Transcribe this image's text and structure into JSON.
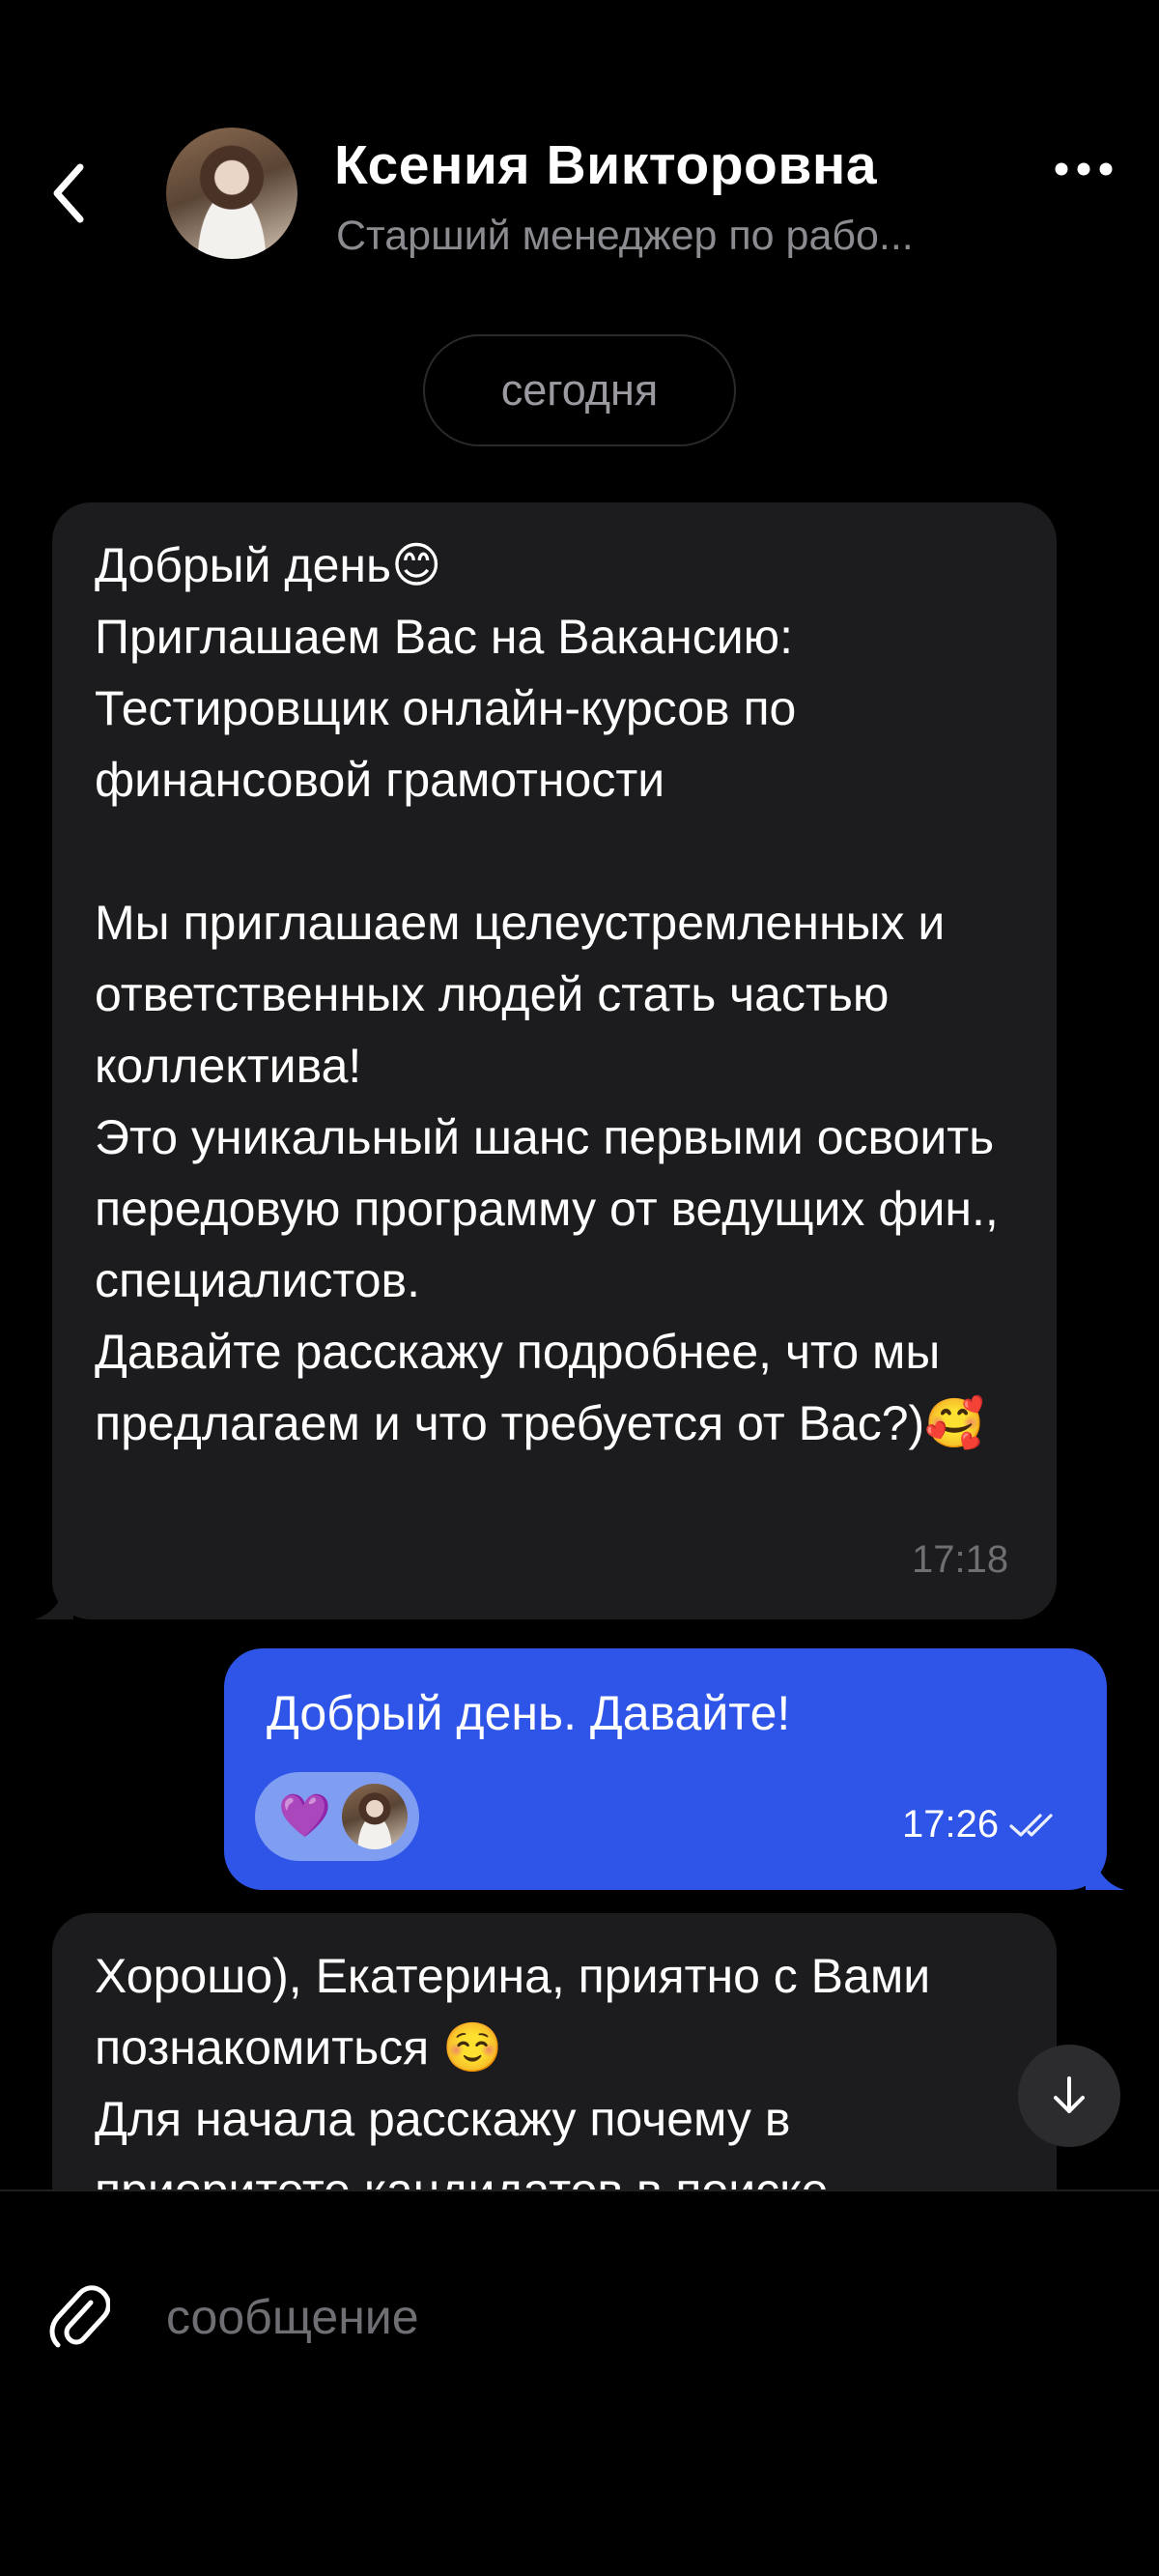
{
  "header": {
    "back_icon": "chevron-left-icon",
    "contact_name": "Ксения Викторовна",
    "contact_subtitle": "Старший менеджер по рабо...",
    "more_icon": "more-horizontal-icon"
  },
  "date_separator": "сегодня",
  "messages": [
    {
      "direction": "incoming",
      "text": "Добрый день😊\nПриглашаем Вас на Вакансию: \nТестировщик онлайн-курсов по финансовой грамотности\n\nМы приглашаем целеустремленных и ответственных людей стать частью коллектива!\nЭто уникальный шанс первыми освоить передовую программу от ведущих фин., специалистов.\nДавайте расскажу подробнее, что мы предлагаем и что требуется от Вас?)🥰",
      "time": "17:18"
    },
    {
      "direction": "outgoing",
      "text": "Добрый день. Давайте!",
      "time": "17:26",
      "status_icon": "double-check-icon",
      "reaction": "💜"
    },
    {
      "direction": "incoming",
      "text": "Хорошо), Екатерина, приятно с Вами познакомиться ☺️\nДля начала расскажу почему в\nприоритете кандидатов в поиске"
    }
  ],
  "composer": {
    "attach_icon": "paperclip-icon",
    "placeholder": "сообщение"
  },
  "scroll_down_icon": "arrow-down-icon",
  "colors": {
    "background": "#000000",
    "incoming_bubble": "#1c1c1e",
    "outgoing_bubble": "#2f55e8",
    "secondary_text": "#8b8b90"
  }
}
